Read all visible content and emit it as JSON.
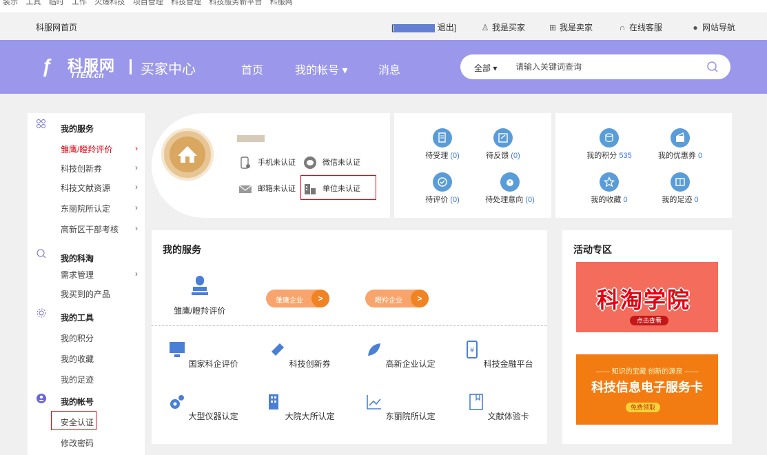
{
  "bookmarks": [
    "装示",
    "工具",
    "临时",
    "工作",
    "火爆科技",
    "项目管理",
    "科技管理",
    "科技服务新平台",
    "科服网"
  ],
  "topbar": {
    "home": "科服网首页",
    "logout": "退出]",
    "buyer": "我是买家",
    "seller": "我是卖家",
    "service": "在线客服",
    "sitemap": "网站导航"
  },
  "header": {
    "logo_name": "科服网",
    "logo_sub": "TTEN.cn",
    "center": "买家中心",
    "nav_home": "首页",
    "nav_account": "我的帐号 ▾",
    "nav_messages": "消息",
    "search_scope": "全部 ▾",
    "search_placeholder": "请输入关键词查询"
  },
  "sidebar": {
    "group1": "我的服务",
    "g1_items": [
      "雏鹰/瞪羚评价",
      "科技创新券",
      "科技文献资源",
      "东丽院所认定",
      "高新区干部考核"
    ],
    "group2": "我的科淘",
    "g2_items": [
      "需求管理",
      "我买到的产品"
    ],
    "group3": "我的工具",
    "g3_items": [
      "我的积分",
      "我的收藏",
      "我的足迹"
    ],
    "group4": "我的帐号",
    "g4_items": [
      "安全认证",
      "修改密码"
    ]
  },
  "profile": {
    "phone": "手机未认证",
    "wechat": "微信未认证",
    "email": "邮箱未认证",
    "company": "单位未认证"
  },
  "stats": {
    "pending_accept": "待受理",
    "pending_accept_num": "(0)",
    "pending_feedback": "待反馈",
    "pending_feedback_num": "(0)",
    "pending_review": "待评价",
    "pending_review_num": "(0)",
    "pending_intent": "待处理意向",
    "pending_intent_num": "(0)",
    "points": "我的积分",
    "points_num": "535",
    "coupons": "我的优惠券",
    "coupons_num": "0",
    "favorites": "我的收藏",
    "favorites_num": "0",
    "footprints": "我的足迹",
    "footprints_num": "0"
  },
  "services": {
    "title": "我的服务",
    "top_label": "雏鹰/瞪羚评价",
    "pill1": "雏鹰企业",
    "pill2": "瞪羚企业",
    "pill_go": ">",
    "items": [
      "国家科企评价",
      "科技创新券",
      "高新企业认定",
      "科技金融平台",
      "大型仪器认定",
      "大院大所认定",
      "东丽院所认定",
      "文献体验卡"
    ]
  },
  "activity": {
    "title": "活动专区",
    "banner1_text": "科淘学院",
    "banner1_btn": "点击查看",
    "banner2_sub": "—— 知识的宝藏 创新的源泉 ——",
    "banner2_main": "科技信息电子服务卡",
    "banner2_btn": "免费领取"
  },
  "colors": {
    "header": "#9b97ea",
    "accent_red": "#e60012",
    "pill": "#f9a46c",
    "icon_blue": "#5a9cd8"
  }
}
